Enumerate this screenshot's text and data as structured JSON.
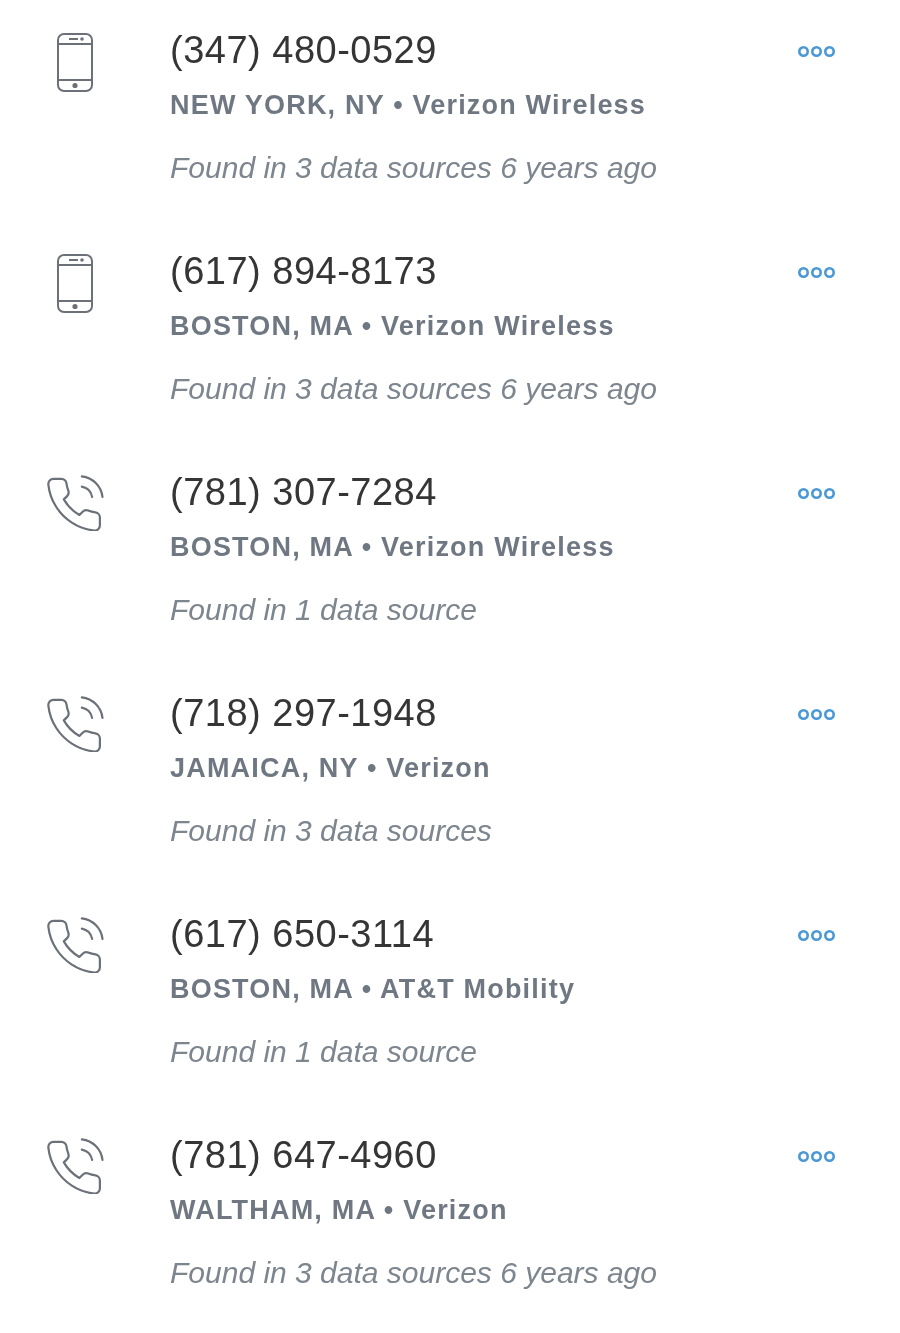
{
  "phones": [
    {
      "kind": "mobile",
      "number": "(347) 480-0529",
      "location": "NEW YORK, NY • Verizon Wireless",
      "found": "Found in 3 data sources 6 years ago"
    },
    {
      "kind": "mobile",
      "number": "(617) 894-8173",
      "location": "BOSTON, MA • Verizon Wireless",
      "found": "Found in 3 data sources 6 years ago"
    },
    {
      "kind": "landline",
      "number": "(781) 307-7284",
      "location": "BOSTON, MA • Verizon Wireless",
      "found": "Found in 1 data source"
    },
    {
      "kind": "landline",
      "number": "(718) 297-1948",
      "location": "JAMAICA, NY • Verizon",
      "found": "Found in 3 data sources"
    },
    {
      "kind": "landline",
      "number": "(617) 650-3114",
      "location": "BOSTON, MA • AT&T Mobility",
      "found": "Found in 1 data source"
    },
    {
      "kind": "landline",
      "number": "(781) 647-4960",
      "location": "WALTHAM, MA • Verizon",
      "found": "Found in 3 data sources 6 years ago"
    }
  ]
}
